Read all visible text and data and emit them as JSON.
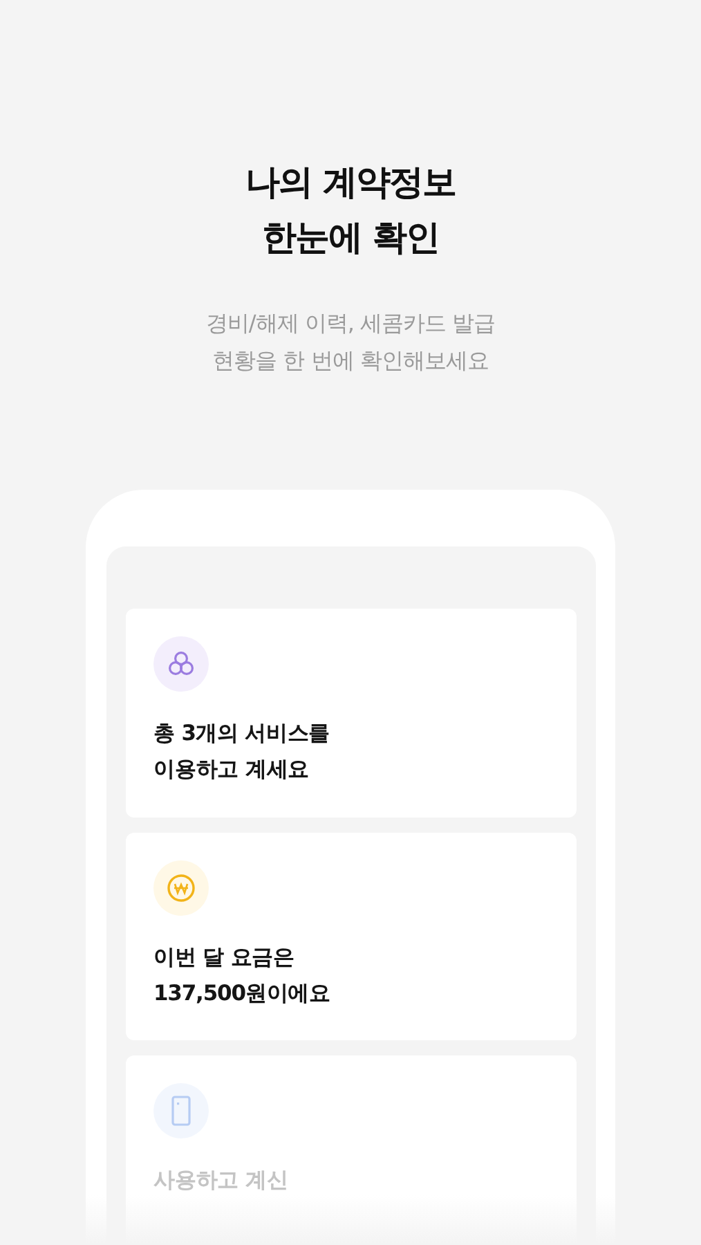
{
  "heading": {
    "lines": [
      "나의 계약정보",
      "한눈에 확인"
    ]
  },
  "subtitle": {
    "lines": [
      "경비/해제 이력, 세콤카드 발급",
      "현황을 한 번에 확인해보세요"
    ]
  },
  "cards": [
    {
      "kind": "services",
      "faded": false,
      "lines": [
        "총 3개의 서비스를",
        "이용하고 계세요"
      ]
    },
    {
      "kind": "won",
      "faded": false,
      "lines": [
        "이번 달 요금은",
        "137,500원이에요"
      ]
    },
    {
      "kind": "card",
      "faded": true,
      "lines": [
        "사용하고 계신"
      ]
    }
  ]
}
